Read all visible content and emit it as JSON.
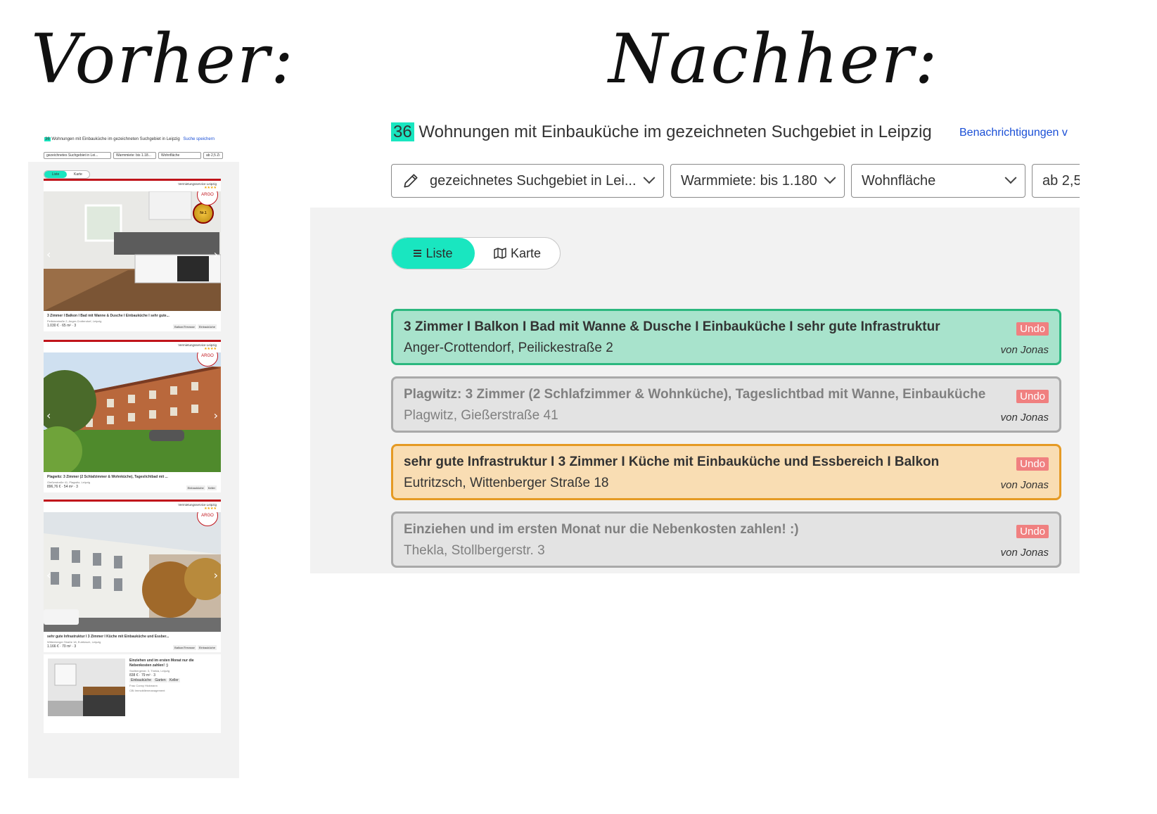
{
  "headings": {
    "before": "Vorher:",
    "after": "Nachher:"
  },
  "colors": {
    "accent": "#19e6c0",
    "link": "#1a4fd6",
    "undo": "#f08080"
  },
  "thumbnail": {
    "count": "36",
    "title": "Wohnungen mit Einbauküche im gezeichneten Suchgebiet in Leipzig",
    "save_link": "Suche speichern",
    "filters": [
      "gezeichnetes Suchgebiet in Lei...",
      "Warmmiete: bis 1.18...",
      "Wohnfläche",
      "ab 2,5 Zi"
    ],
    "toggle": {
      "list": "Liste",
      "map": "Karte"
    },
    "cards": [
      {
        "provider": "Vermietungsservice Leipzig",
        "rating": "★★★★",
        "badge": "ARGO",
        "title": "3 Zimmer I Balkon I Bad mit Wanne & Dusche I Einbauküche I sehr gute...",
        "address": "Peilickestraße 2, Anger-Crottendorf, Leipzig",
        "price": "1.030 €",
        "area": "65 m²",
        "rooms": "3",
        "tags": [
          "Balkon/Terrasse",
          "Einbauküche"
        ]
      },
      {
        "provider": "Vermietungsservice Leipzig",
        "rating": "★★★★",
        "badge": "ARGO",
        "title": "Plagwitz: 3 Zimmer (2 Schlafzimmer & Wohnküche), Tageslichtbad mit ...",
        "address": "Gießerstraße 41, Plagwitz, Leipzig",
        "price": "896,76 €",
        "area": "54 m²",
        "rooms": "3",
        "tags": [
          "Einbauküche",
          "Keller"
        ]
      },
      {
        "provider": "Vermietungsservice Leipzig",
        "rating": "★★★★",
        "badge": "ARGO",
        "title": "sehr gute Infrastruktur I 3 Zimmer I Küche mit Einbauküche und Essber...",
        "address": "Wittenberger Straße 18, Eutritzsch, Leipzig",
        "price": "1.166 €",
        "area": "70 m²",
        "rooms": "3",
        "tags": [
          "Balkon/Terrasse",
          "Einbauküche"
        ]
      },
      {
        "title": "Einziehen und im ersten Monat nur die Nebenkosten zahlen! :)",
        "address": "Stollbergerstr. 3, Thekla, Leipzig",
        "price": "838 €",
        "area": "79 m²",
        "rooms": "3",
        "tags": [
          "Einbauküche",
          "Garten",
          "Keller"
        ],
        "contact": "Frau Conny Hickmann",
        "company": "CBI Immobilienmanagement"
      }
    ]
  },
  "results": {
    "count": "36",
    "title": "Wohnungen mit Einbauküche im gezeichneten Suchgebiet in Leipzig",
    "notify_link": "Benachrichtigungen v",
    "filters": [
      "gezeichnetes Suchgebiet in Lei...",
      "Warmmiete: bis 1.180 ...",
      "Wohnfläche",
      "ab 2,5"
    ],
    "view_toggle": {
      "list": "Liste",
      "map": "Karte"
    },
    "entries": [
      {
        "title": "3 Zimmer I Balkon I Bad mit Wanne & Dusche I Einbauküche I sehr gute Infrastruktur",
        "address": "Anger-Crottendorf, Peilickestraße 2",
        "action": "Undo",
        "by": "von Jonas",
        "state": "green"
      },
      {
        "title": "Plagwitz: 3 Zimmer (2 Schlafzimmer & Wohnküche), Tageslichtbad mit Wanne, Einbauküche",
        "address": "Plagwitz, Gießerstraße 41",
        "action": "Undo",
        "by": "von Jonas",
        "state": "grey"
      },
      {
        "title": "sehr gute Infrastruktur I 3 Zimmer I Küche mit Einbauküche und Essbereich I Balkon",
        "address": "Eutritzsch, Wittenberger Straße 18",
        "action": "Undo",
        "by": "von Jonas",
        "state": "orange"
      },
      {
        "title": "Einziehen und im ersten Monat nur die Nebenkosten zahlen! :)",
        "address": "Thekla, Stollbergerstr. 3",
        "action": "Undo",
        "by": "von Jonas",
        "state": "grey"
      }
    ]
  }
}
